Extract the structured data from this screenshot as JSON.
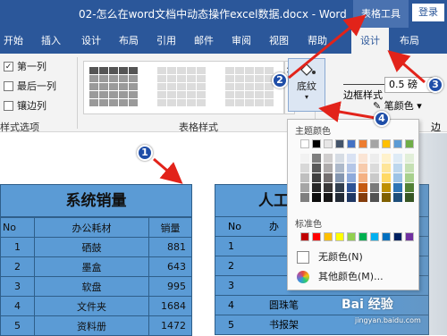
{
  "titlebar": {
    "doc_title": "02-怎么在word文档中动态操作excel数据.docx - Word",
    "context_tab": "表格工具",
    "login": "登录"
  },
  "tabs": [
    {
      "label": "开始"
    },
    {
      "label": "插入"
    },
    {
      "label": "设计"
    },
    {
      "label": "布局"
    },
    {
      "label": "引用"
    },
    {
      "label": "邮件"
    },
    {
      "label": "审阅"
    },
    {
      "label": "视图"
    },
    {
      "label": "帮助"
    },
    {
      "label": "设计",
      "active": true
    },
    {
      "label": "布局"
    }
  ],
  "ribbon": {
    "options": [
      {
        "label": "第一列",
        "checked": true
      },
      {
        "label": "最后一列",
        "checked": false
      },
      {
        "label": "镶边列",
        "checked": false
      }
    ],
    "options_group": "样式选项",
    "styles_group": "表格样式",
    "shading_label": "底纹",
    "border_styles_label": "边框样式",
    "weight_value": "0.5 磅",
    "pen_color_label": "笔颜色",
    "borders_group": "边"
  },
  "color_menu": {
    "theme_colors_label": "主题颜色",
    "standard_colors_label": "标准色",
    "no_color_label": "无颜色(N)",
    "more_colors_label": "其他颜色(M)...",
    "theme_row": [
      "#ffffff",
      "#000000",
      "#e7e6e6",
      "#44546a",
      "#4472c4",
      "#ed7d31",
      "#a5a5a5",
      "#ffc000",
      "#5b9bd5",
      "#70ad47"
    ],
    "shades": [
      [
        "#f2f2f2",
        "#7f7f7f",
        "#d0cece",
        "#d6dce4",
        "#d9e2f3",
        "#fbe5d5",
        "#ededed",
        "#fff2cc",
        "#deebf6",
        "#e2efd9"
      ],
      [
        "#d8d8d8",
        "#595959",
        "#aeabab",
        "#adb9ca",
        "#b4c6e7",
        "#f7cbac",
        "#dbdbdb",
        "#fee599",
        "#bdd7ee",
        "#c5e0b3"
      ],
      [
        "#bfbfbf",
        "#3f3f3f",
        "#757070",
        "#8496b0",
        "#8eaadb",
        "#f4b183",
        "#c9c9c9",
        "#ffd965",
        "#9dc3e6",
        "#a8d08d"
      ],
      [
        "#a5a5a5",
        "#262626",
        "#3a3838",
        "#323f4f",
        "#2f5496",
        "#c55a11",
        "#7b7b7b",
        "#bf9000",
        "#2e75b5",
        "#538135"
      ],
      [
        "#7f7f7f",
        "#0c0c0c",
        "#171616",
        "#222a35",
        "#1f3864",
        "#833c0b",
        "#525252",
        "#7f6000",
        "#1e4e79",
        "#375623"
      ]
    ],
    "standard_row": [
      "#c00000",
      "#ff0000",
      "#ffc000",
      "#ffff00",
      "#92d050",
      "#00b050",
      "#00b0f0",
      "#0070c0",
      "#002060",
      "#7030a0"
    ]
  },
  "table1": {
    "title": "系统销量",
    "headers": [
      "No",
      "办公耗材",
      "销量"
    ],
    "rows": [
      [
        "1",
        "硒鼓",
        "881"
      ],
      [
        "2",
        "墨盒",
        "643"
      ],
      [
        "3",
        "软盘",
        "995"
      ],
      [
        "4",
        "文件夹",
        "1684"
      ],
      [
        "5",
        "资料册",
        "1472"
      ]
    ]
  },
  "table2": {
    "title": "人工",
    "headers": [
      "No",
      "办"
    ],
    "rows": [
      [
        "1",
        ""
      ],
      [
        "2",
        ""
      ],
      [
        "3",
        ""
      ],
      [
        "4",
        "圆珠笔"
      ],
      [
        "5",
        "书报架"
      ]
    ]
  },
  "callouts": [
    "1",
    "2",
    "3",
    "4"
  ],
  "watermark": {
    "brand": "Bai 经验",
    "url": "jingyan.baidu.com"
  }
}
